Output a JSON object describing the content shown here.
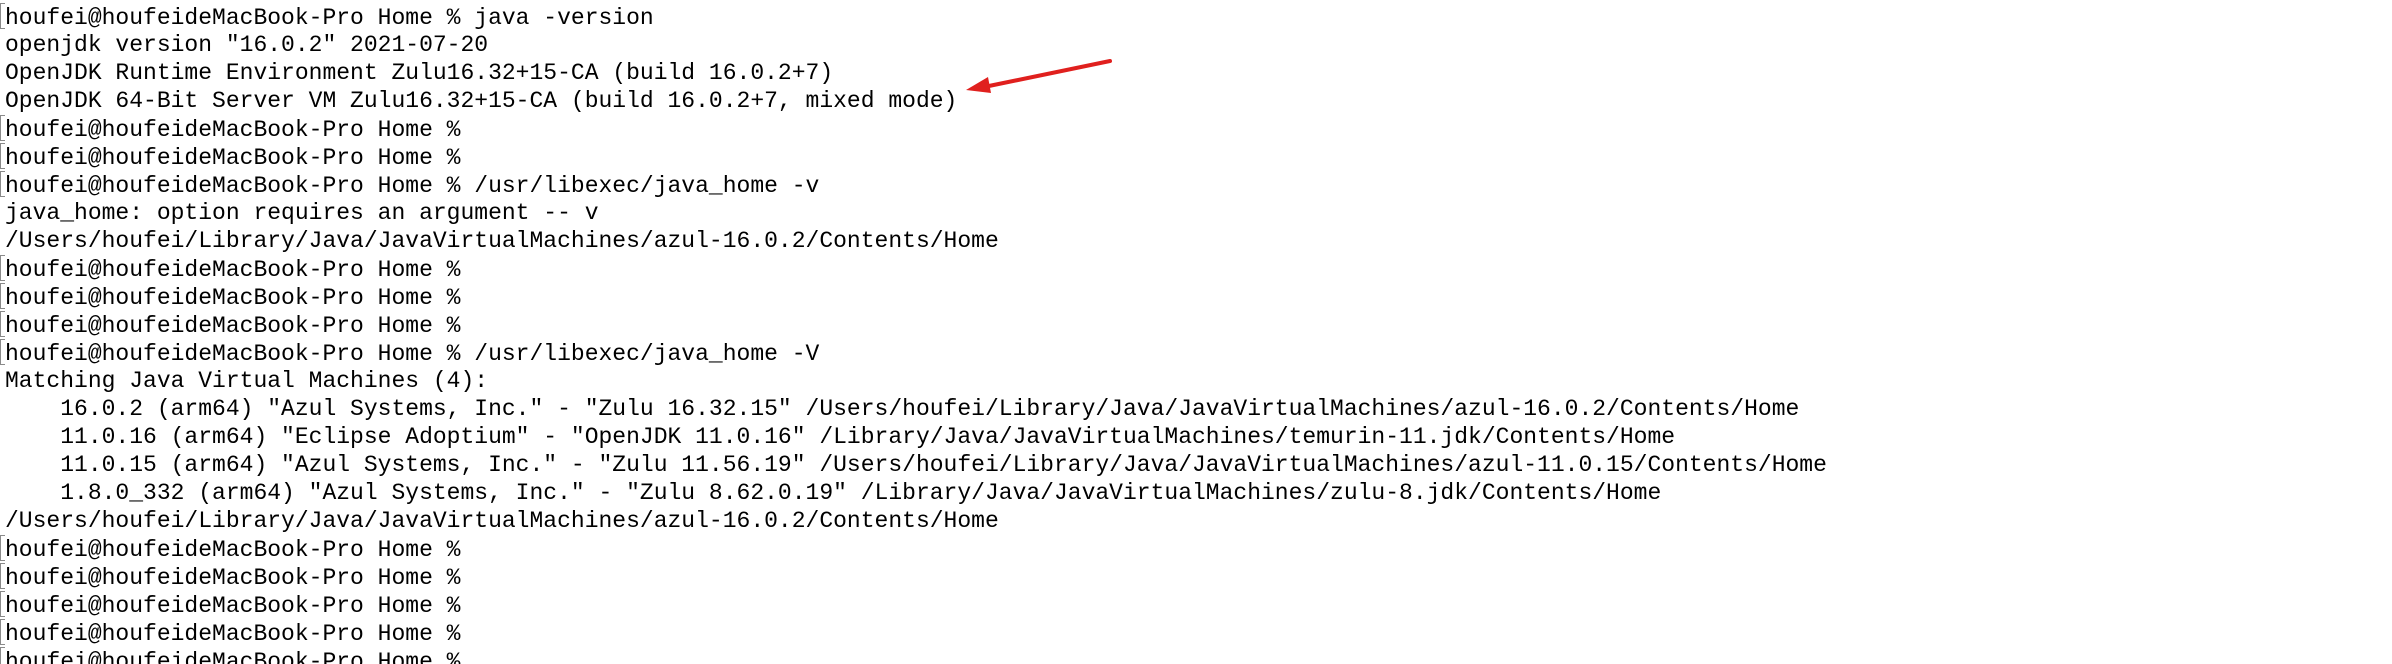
{
  "terminal": {
    "lines": [
      {
        "text": "houfei@houfeideMacBook-Pro Home % java -version",
        "prompt": true
      },
      {
        "text": "openjdk version \"16.0.2\" 2021-07-20",
        "prompt": false
      },
      {
        "text": "OpenJDK Runtime Environment Zulu16.32+15-CA (build 16.0.2+7)",
        "prompt": false
      },
      {
        "text": "OpenJDK 64-Bit Server VM Zulu16.32+15-CA (build 16.0.2+7, mixed mode)",
        "prompt": false
      },
      {
        "text": "houfei@houfeideMacBook-Pro Home %",
        "prompt": true
      },
      {
        "text": "houfei@houfeideMacBook-Pro Home %",
        "prompt": true
      },
      {
        "text": "houfei@houfeideMacBook-Pro Home % /usr/libexec/java_home -v",
        "prompt": true
      },
      {
        "text": "java_home: option requires an argument -- v",
        "prompt": false
      },
      {
        "text": "/Users/houfei/Library/Java/JavaVirtualMachines/azul-16.0.2/Contents/Home",
        "prompt": false
      },
      {
        "text": "houfei@houfeideMacBook-Pro Home %",
        "prompt": true
      },
      {
        "text": "houfei@houfeideMacBook-Pro Home %",
        "prompt": true
      },
      {
        "text": "houfei@houfeideMacBook-Pro Home %",
        "prompt": true
      },
      {
        "text": "houfei@houfeideMacBook-Pro Home % /usr/libexec/java_home -V",
        "prompt": true
      },
      {
        "text": "Matching Java Virtual Machines (4):",
        "prompt": false
      },
      {
        "text": "    16.0.2 (arm64) \"Azul Systems, Inc.\" - \"Zulu 16.32.15\" /Users/houfei/Library/Java/JavaVirtualMachines/azul-16.0.2/Contents/Home",
        "prompt": false
      },
      {
        "text": "    11.0.16 (arm64) \"Eclipse Adoptium\" - \"OpenJDK 11.0.16\" /Library/Java/JavaVirtualMachines/temurin-11.jdk/Contents/Home",
        "prompt": false
      },
      {
        "text": "    11.0.15 (arm64) \"Azul Systems, Inc.\" - \"Zulu 11.56.19\" /Users/houfei/Library/Java/JavaVirtualMachines/azul-11.0.15/Contents/Home",
        "prompt": false
      },
      {
        "text": "    1.8.0_332 (arm64) \"Azul Systems, Inc.\" - \"Zulu 8.62.0.19\" /Library/Java/JavaVirtualMachines/zulu-8.jdk/Contents/Home",
        "prompt": false
      },
      {
        "text": "/Users/houfei/Library/Java/JavaVirtualMachines/azul-16.0.2/Contents/Home",
        "prompt": false
      },
      {
        "text": "houfei@houfeideMacBook-Pro Home %",
        "prompt": true
      },
      {
        "text": "houfei@houfeideMacBook-Pro Home %",
        "prompt": true
      },
      {
        "text": "houfei@houfeideMacBook-Pro Home %",
        "prompt": true
      },
      {
        "text": "houfei@houfeideMacBook-Pro Home %",
        "prompt": true
      },
      {
        "text": "houfei@houfeideMacBook-Pro Home %",
        "prompt": true
      }
    ]
  },
  "annotation": {
    "arrow_color": "#e0201e",
    "icon": "red-arrow-icon"
  }
}
